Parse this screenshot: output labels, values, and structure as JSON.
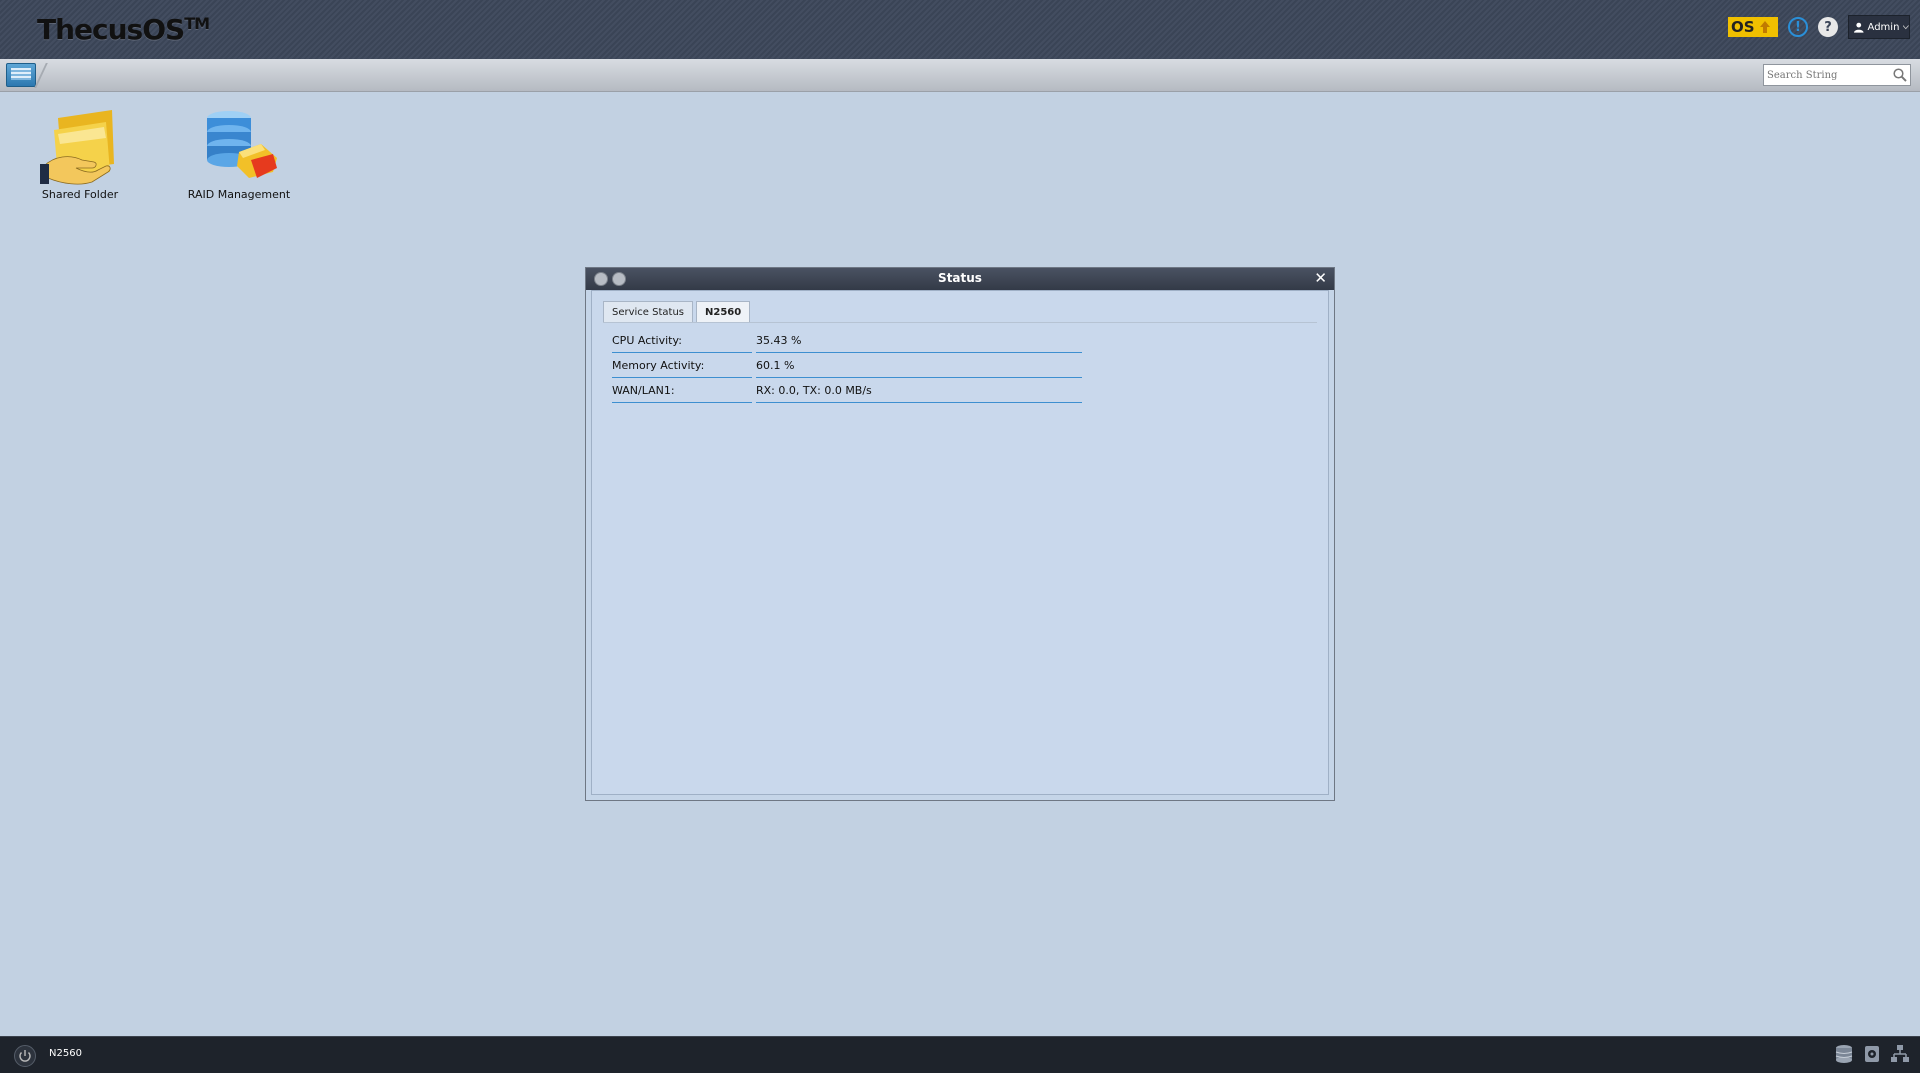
{
  "header": {
    "logo_text": "ThecusOS",
    "logo_tm": "TM",
    "os_badge": "OS",
    "admin_label": "Admin"
  },
  "toolbar": {
    "search_placeholder": "Search String"
  },
  "desktop": {
    "icons": [
      {
        "label": "Shared Folder"
      },
      {
        "label": "RAID Management"
      }
    ]
  },
  "window": {
    "title": "Status",
    "tabs": [
      {
        "label": "Service Status",
        "active": false
      },
      {
        "label": "N2560",
        "active": true
      }
    ],
    "rows": [
      {
        "key": "CPU Activity:",
        "value": "35.43 %"
      },
      {
        "key": "Memory Activity:",
        "value": "60.1 %"
      },
      {
        "key": "WAN/LAN1:",
        "value": "RX: 0.0, TX: 0.0 MB/s"
      }
    ]
  },
  "taskbar": {
    "hostname": "N2560"
  },
  "colors": {
    "desktop_bg": "#c2d1e2",
    "os_badge": "#f0c000",
    "info_blue": "#2a8fd8",
    "row_underline": "#3d8fd0"
  }
}
